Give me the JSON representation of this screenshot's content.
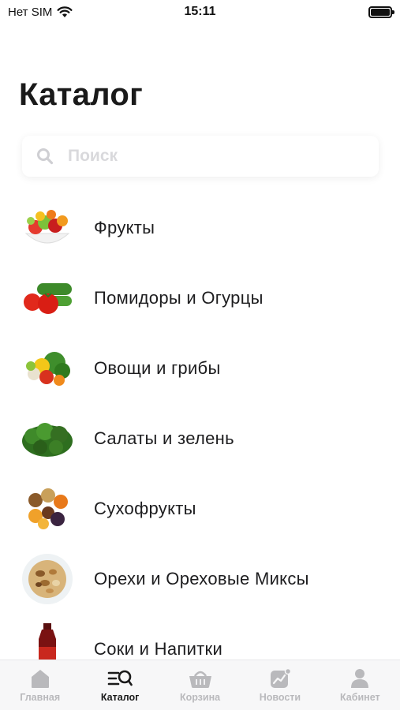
{
  "status": {
    "carrier": "Нет SIM",
    "time": "15:11"
  },
  "title": "Каталог",
  "search": {
    "placeholder": "Поиск"
  },
  "categories": [
    {
      "label": "Фрукты",
      "icon": "fruit-bowl-image"
    },
    {
      "label": "Помидоры и Огурцы",
      "icon": "tomatoes-cucumbers-image"
    },
    {
      "label": "Овощи и грибы",
      "icon": "vegetables-image"
    },
    {
      "label": "Салаты и зелень",
      "icon": "greens-image"
    },
    {
      "label": "Сухофрукты",
      "icon": "dried-fruits-image"
    },
    {
      "label": "Орехи и Ореховые Миксы",
      "icon": "nuts-image"
    },
    {
      "label": "Соки и Напитки",
      "icon": "juice-bottle-image"
    }
  ],
  "tabs": [
    {
      "label": "Главная",
      "icon": "home-icon",
      "active": false
    },
    {
      "label": "Каталог",
      "icon": "catalog-search-icon",
      "active": true
    },
    {
      "label": "Корзина",
      "icon": "basket-icon",
      "active": false
    },
    {
      "label": "Новости",
      "icon": "news-chart-icon",
      "active": false
    },
    {
      "label": "Кабинет",
      "icon": "user-icon",
      "active": false
    }
  ],
  "colors": {
    "active_tab": "#1a1a1a",
    "inactive_tab": "#b9b9bc",
    "placeholder": "#d9d9dc"
  }
}
